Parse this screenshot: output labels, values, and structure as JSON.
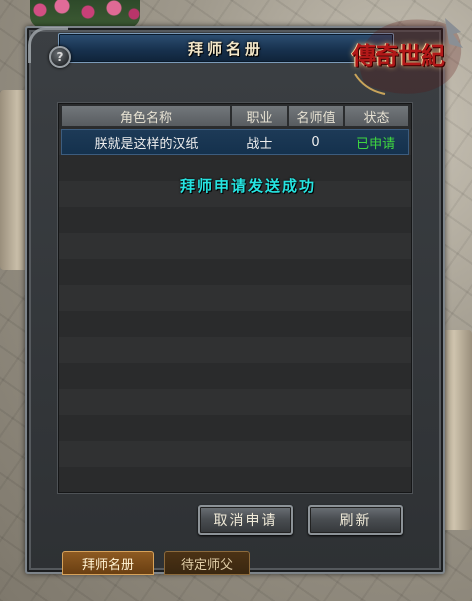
{
  "window": {
    "title": "拜师名册",
    "help_label": "?"
  },
  "logo": {
    "text": "傳奇世紀"
  },
  "table": {
    "columns": [
      "角色名称",
      "职业",
      "名师值",
      "状态"
    ],
    "rows": [
      {
        "name": "朕就是这样的汉纸",
        "class": "战士",
        "mentor_value": "0",
        "status": "已申请"
      }
    ]
  },
  "toast": {
    "message": "拜师申请发送成功"
  },
  "buttons": {
    "cancel_label": "取消申请",
    "refresh_label": "刷新"
  },
  "tabs": [
    {
      "label": "拜师名册",
      "active": true
    },
    {
      "label": "待定师父",
      "active": false
    }
  ],
  "colors": {
    "status_applied": "#3fd83f",
    "toast": "#26e3e0",
    "title_bar": "#18324f",
    "row_selected": "#1d3a57"
  }
}
